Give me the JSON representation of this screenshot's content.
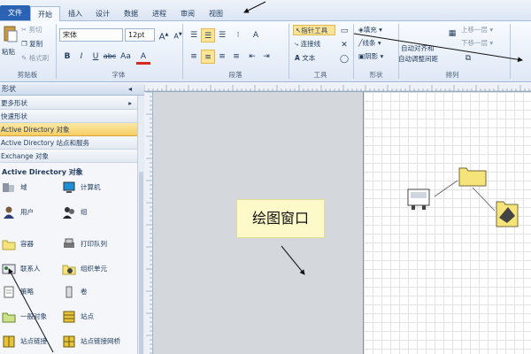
{
  "tabs": {
    "file": "文件",
    "home": "开始",
    "insert": "插入",
    "design": "设计",
    "data": "数据",
    "process": "进程",
    "review": "审阅",
    "view": "视图"
  },
  "clipboard": {
    "paste": "粘贴",
    "cut": "剪切",
    "copy": "复制",
    "format_painter": "格式刷",
    "group_label": "剪贴板"
  },
  "font": {
    "family": "宋体",
    "size": "12pt",
    "group_label": "字体"
  },
  "paragraph": {
    "group_label": "段落"
  },
  "tools": {
    "pointer": "指针工具",
    "connector": "连接线",
    "text": "文本",
    "group_label": "工具"
  },
  "shape": {
    "fill": "填充",
    "line": "线条",
    "shadow": "阴影",
    "group_label": "形状"
  },
  "arrange": {
    "auto_align": "自动对齐和",
    "auto_space": "自动调整间距",
    "bring_forward": "上移一层",
    "send_backward": "下移一层",
    "group_label": "排列"
  },
  "panel": {
    "title": "形状",
    "rows": [
      "更多形状",
      "快速形状",
      "Active Directory 对象",
      "Active Directory 站点和服务",
      "Exchange 对象"
    ],
    "stencil_title": "Active Directory 对象",
    "shapes": [
      {
        "label": "域"
      },
      {
        "label": "计算机"
      },
      {
        "label": "用户"
      },
      {
        "label": "组"
      },
      {
        "label": "容器"
      },
      {
        "label": "打印队列"
      },
      {
        "label": "联系人"
      },
      {
        "label": "组织单元"
      },
      {
        "label": "策略"
      },
      {
        "label": "卷"
      },
      {
        "label": "一般对象"
      },
      {
        "label": "站点"
      },
      {
        "label": "站点链接"
      },
      {
        "label": "站点链接网桥"
      }
    ]
  },
  "canvas": {
    "callout": "绘图窗口"
  }
}
